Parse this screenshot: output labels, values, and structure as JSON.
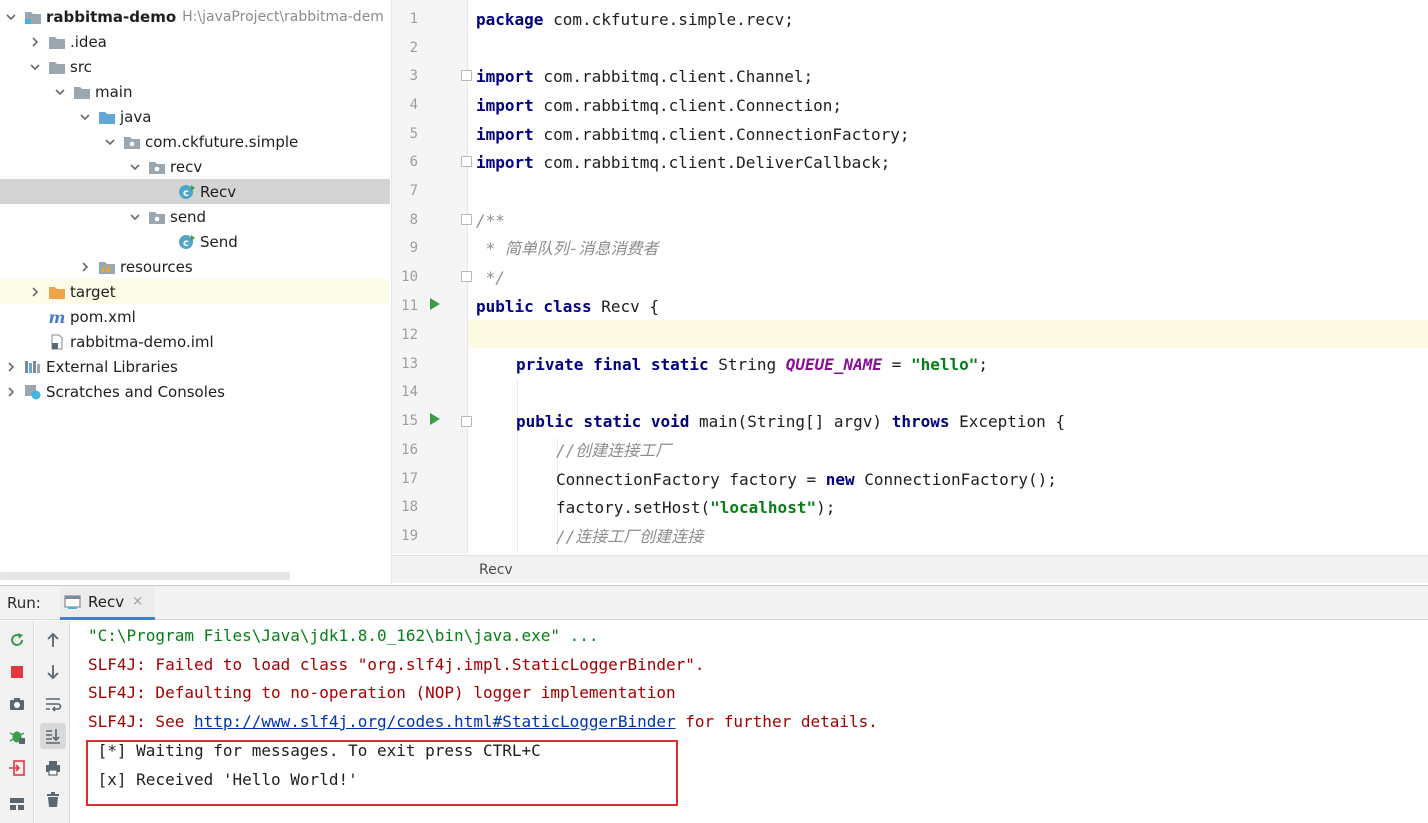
{
  "project_tree": {
    "root": {
      "label": "rabbitma-demo",
      "path": "H:\\javaProject\\rabbitma-dem"
    },
    "items": [
      {
        "label": ".idea"
      },
      {
        "label": "src"
      },
      {
        "label": "main"
      },
      {
        "label": "java"
      },
      {
        "label": "com.ckfuture.simple"
      },
      {
        "label": "recv"
      },
      {
        "label": "Recv"
      },
      {
        "label": "send"
      },
      {
        "label": "Send"
      },
      {
        "label": "resources"
      },
      {
        "label": "target"
      },
      {
        "label": "pom.xml"
      },
      {
        "label": "rabbitma-demo.iml"
      },
      {
        "label": "External Libraries"
      },
      {
        "label": "Scratches and Consoles"
      }
    ]
  },
  "editor": {
    "line_numbers": [
      "1",
      "2",
      "3",
      "4",
      "5",
      "6",
      "7",
      "8",
      "9",
      "10",
      "11",
      "12",
      "13",
      "14",
      "15",
      "16",
      "17",
      "18",
      "19"
    ],
    "code": {
      "l1_kw": "package",
      "l1_rest": " com.ckfuture.simple.recv;",
      "import_kw": "import",
      "l3": " com.rabbitmq.client.Channel;",
      "l4": " com.rabbitmq.client.Connection;",
      "l5": " com.rabbitmq.client.ConnectionFactory;",
      "l6": " com.rabbitmq.client.DeliverCallback;",
      "l8": "/**",
      "l9": " * 简单队列-消息消费者",
      "l10": " */",
      "l11_kw": "public class",
      "l11_rest": " Recv {",
      "l13_kw": "private final static",
      "l13_type": " String ",
      "l13_const": "QUEUE_NAME",
      "l13_eq": " = ",
      "l13_str": "\"hello\"",
      "l13_end": ";",
      "l15_kw": "public static void",
      "l15_mid": " main(String[] argv) ",
      "l15_kw2": "throws",
      "l15_end": " Exception {",
      "l16": "//创建连接工厂",
      "l17_a": "ConnectionFactory factory = ",
      "l17_kw": "new",
      "l17_b": " ConnectionFactory();",
      "l18_a": "factory.setHost(",
      "l18_str": "\"localhost\"",
      "l18_b": ");",
      "l19": "//连接工厂创建连接"
    },
    "breadcrumb": "Recv"
  },
  "run_panel": {
    "title": "Run:",
    "tab_label": "Recv",
    "tab_close": "×",
    "console": {
      "cmd": "\"C:\\Program Files\\Java\\jdk1.8.0_162\\bin\\java.exe\" ...",
      "err1": "SLF4J: Failed to load class \"org.slf4j.impl.StaticLoggerBinder\".",
      "err2": "SLF4J: Defaulting to no-operation (NOP) logger implementation",
      "err3_a": "SLF4J: See ",
      "err3_link": "http://www.slf4j.org/codes.html#StaticLoggerBinder",
      "err3_b": " for further details.",
      "out1": " [*] Waiting for messages. To exit press CTRL+C",
      "out2": " [x] Received 'Hello World!'"
    }
  },
  "colors": {
    "keyword": "#000080",
    "string": "#067d17",
    "comment": "#8c8c8c",
    "error": "#a30000",
    "highlight": "#e52c2c"
  }
}
